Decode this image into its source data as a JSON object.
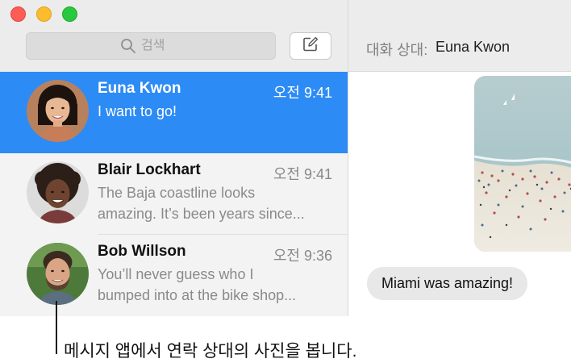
{
  "search": {
    "placeholder": "검색"
  },
  "conversations": [
    {
      "name": "Euna Kwon",
      "time": "오전 9:41",
      "preview_lines": [
        "I want to go!"
      ],
      "selected": true
    },
    {
      "name": "Blair Lockhart",
      "time": "오전 9:41",
      "preview_lines": [
        "The Baja coastline looks",
        "amazing. It’s been years since..."
      ],
      "selected": false
    },
    {
      "name": "Bob Willson",
      "time": "오전 9:36",
      "preview_lines": [
        "You’ll never guess who I",
        "bumped into at the bike shop..."
      ],
      "selected": false
    }
  ],
  "chat": {
    "to_label": "대화 상대:",
    "to_name": "Euna Kwon",
    "messages": [
      {
        "text": "Miami was amazing!",
        "incoming": true
      }
    ]
  },
  "caption": "메시지 앱에서 연락 상대의 사진을 봅니다.",
  "colors": {
    "selected_row": "#2d8bf5",
    "incoming_bubble": "#e8e8e9",
    "sidebar_bg": "#f4f3f4"
  },
  "icons": [
    "search-icon",
    "compose-icon"
  ]
}
